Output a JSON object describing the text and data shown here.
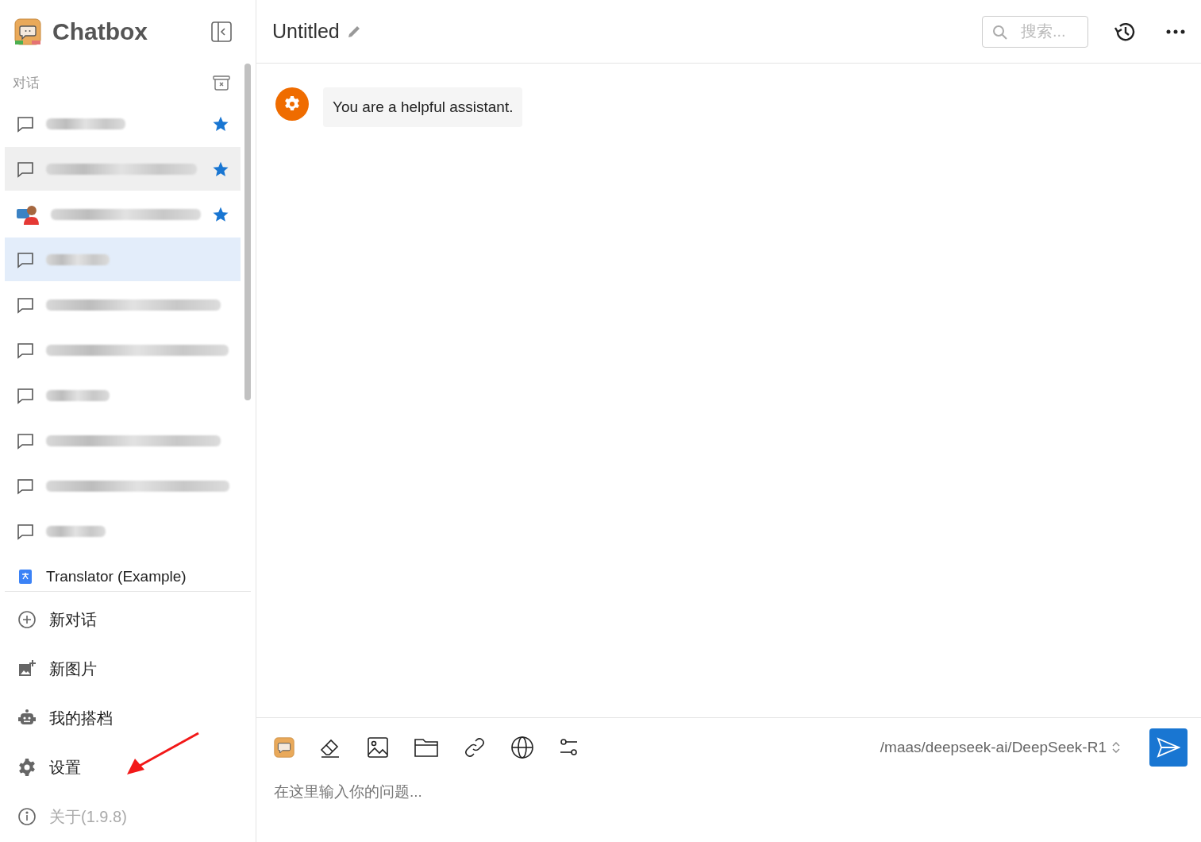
{
  "sidebar": {
    "app_name": "Chatbox",
    "section_label": "对话",
    "conversations": [
      {
        "kind": "chat",
        "starred": true,
        "selected": false,
        "hovered": false
      },
      {
        "kind": "chat",
        "starred": true,
        "selected": false,
        "hovered": true
      },
      {
        "kind": "avatar",
        "starred": true,
        "selected": false,
        "hovered": false
      },
      {
        "kind": "chat",
        "starred": false,
        "selected": true,
        "hovered": false
      },
      {
        "kind": "chat",
        "starred": false,
        "selected": false,
        "hovered": false
      },
      {
        "kind": "chat",
        "starred": false,
        "selected": false,
        "hovered": false
      },
      {
        "kind": "chat",
        "starred": false,
        "selected": false,
        "hovered": false
      },
      {
        "kind": "chat",
        "starred": false,
        "selected": false,
        "hovered": false
      },
      {
        "kind": "chat",
        "starred": false,
        "selected": false,
        "hovered": false
      },
      {
        "kind": "chat",
        "starred": false,
        "selected": false,
        "hovered": false
      },
      {
        "kind": "translator",
        "title": "Translator (Example)",
        "starred": false,
        "selected": false,
        "hovered": false
      }
    ],
    "menu": [
      {
        "kind": "new-chat",
        "label": "新对话",
        "disabled": false
      },
      {
        "kind": "new-image",
        "label": "新图片",
        "disabled": false
      },
      {
        "kind": "partners",
        "label": "我的搭档",
        "disabled": false
      },
      {
        "kind": "settings",
        "label": "设置",
        "disabled": false
      },
      {
        "kind": "about",
        "label": "关于(1.9.8)",
        "disabled": true
      }
    ]
  },
  "header": {
    "title": "Untitled",
    "search": {
      "placeholder": "搜索..."
    }
  },
  "messages": [
    {
      "kind": "system",
      "text": "You are a helpful assistant."
    }
  ],
  "composer": {
    "model": "/maas/deepseek-ai/DeepSeek-R1",
    "placeholder": "在这里输入你的问题..."
  }
}
